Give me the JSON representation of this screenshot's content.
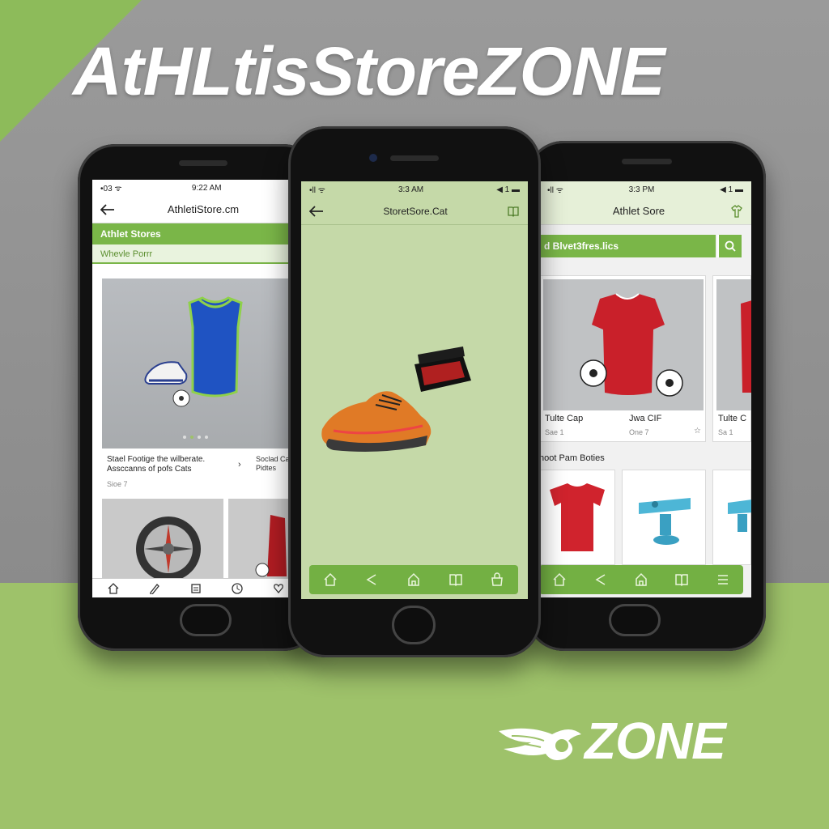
{
  "headline": "AtHLtisStoreZONE",
  "logo_text": "ZONE",
  "colors": {
    "accent_green": "#7ab648",
    "background_gray": "#8f8f8f",
    "background_green": "#9ec26a"
  },
  "left_phone": {
    "status": {
      "left": "•03 ᯤ",
      "time": "9:22 AM",
      "right": ""
    },
    "nav": {
      "back_icon": "arrow-left-icon",
      "title": "AthletiStore.cm"
    },
    "green_bar": "Athlet Stores",
    "sub_bar": "Whevle Porrr",
    "caption": "Stael Footige the wilberate. Assccanns of pofs Cats",
    "caption_meta": "Sioe 7",
    "side_caption": "Soclad Cal Pidtes",
    "tabbar_icons": [
      "home-icon",
      "edit-icon",
      "list-icon",
      "clock-icon",
      "heart-icon"
    ]
  },
  "center_phone": {
    "status": {
      "left": "•ll ᯤ",
      "time": "3:3 AM",
      "right": "◀ 1 ▬"
    },
    "nav": {
      "back_icon": "arrow-left-icon",
      "title": "StoretSore.Cat",
      "right_icon": "book-icon"
    },
    "tabbar_icons": [
      "home-icon",
      "share-icon",
      "store-icon",
      "book-icon",
      "bag-icon"
    ]
  },
  "right_phone": {
    "status": {
      "left": "•ll ᯤ",
      "time": "3:3 PM",
      "right": "◀ 1 ▬"
    },
    "nav": {
      "title": "Athlet Sore",
      "right_icon": "shirt-icon"
    },
    "search_label": "d Blvet3fres.lics",
    "cards": [
      {
        "title": "Tulte Cap",
        "sub": "Sae 1"
      },
      {
        "title": "Jwa CIF",
        "sub": "One 7"
      },
      {
        "title": "Tulte C",
        "sub": "Sa 1"
      }
    ],
    "section_title": "hoot Pam Boties",
    "tabbar_icons": [
      "home-icon",
      "share-icon",
      "store-icon",
      "book-icon",
      "menu-icon"
    ]
  }
}
